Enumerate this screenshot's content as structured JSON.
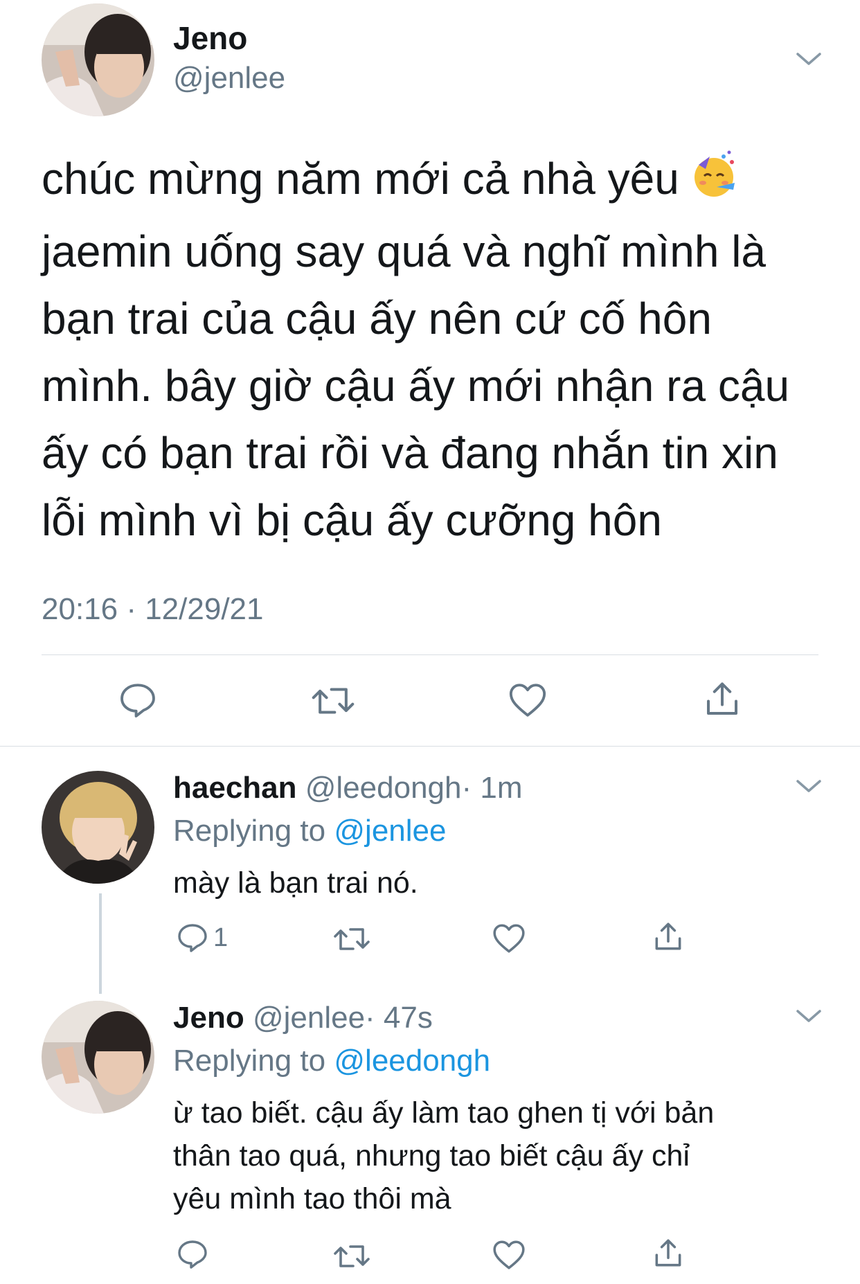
{
  "main_tweet": {
    "name": "Jeno",
    "handle": "@jenlee",
    "avatar_icon": "profile-photo",
    "text": "chúc mừng năm mới cả nhà yêu",
    "text_rest": "jaemin uống say quá và nghĩ mình là\nbạn trai của cậu ấy nên cứ cố hôn\nmình. bây giờ cậu ấy mới nhận ra cậu\nấy có bạn trai rồi và đang nhắn tin xin\nlỗi mình vì bị cậu ấy cưỡng hôn",
    "emoji": "🥳",
    "timestamp": "20:16 · 12/29/21",
    "actions": [
      "reply-icon",
      "retweet-icon",
      "like-icon",
      "share-icon"
    ]
  },
  "replies": [
    {
      "name": "haechan",
      "handle": "@leedongh",
      "time": "· 1m",
      "replying_label": "Replying to",
      "replying_to": "@jenlee",
      "text": "mày là bạn trai nó.",
      "reply_count": "1",
      "avatar_icon": "profile-photo"
    },
    {
      "name": "Jeno",
      "handle": "@jenlee",
      "time": "· 47s",
      "replying_label": "Replying to",
      "replying_to": "@leedongh",
      "text": "ừ tao biết. cậu ấy làm tao ghen tị với bản\nthân tao quá, nhưng tao biết cậu ấy chỉ\nyêu mình tao thôi mà",
      "reply_count": "",
      "avatar_icon": "profile-photo"
    }
  ],
  "colors": {
    "text": "#14171a",
    "muted": "#657786",
    "link": "#1b95e0",
    "divider": "#d9dee3"
  }
}
